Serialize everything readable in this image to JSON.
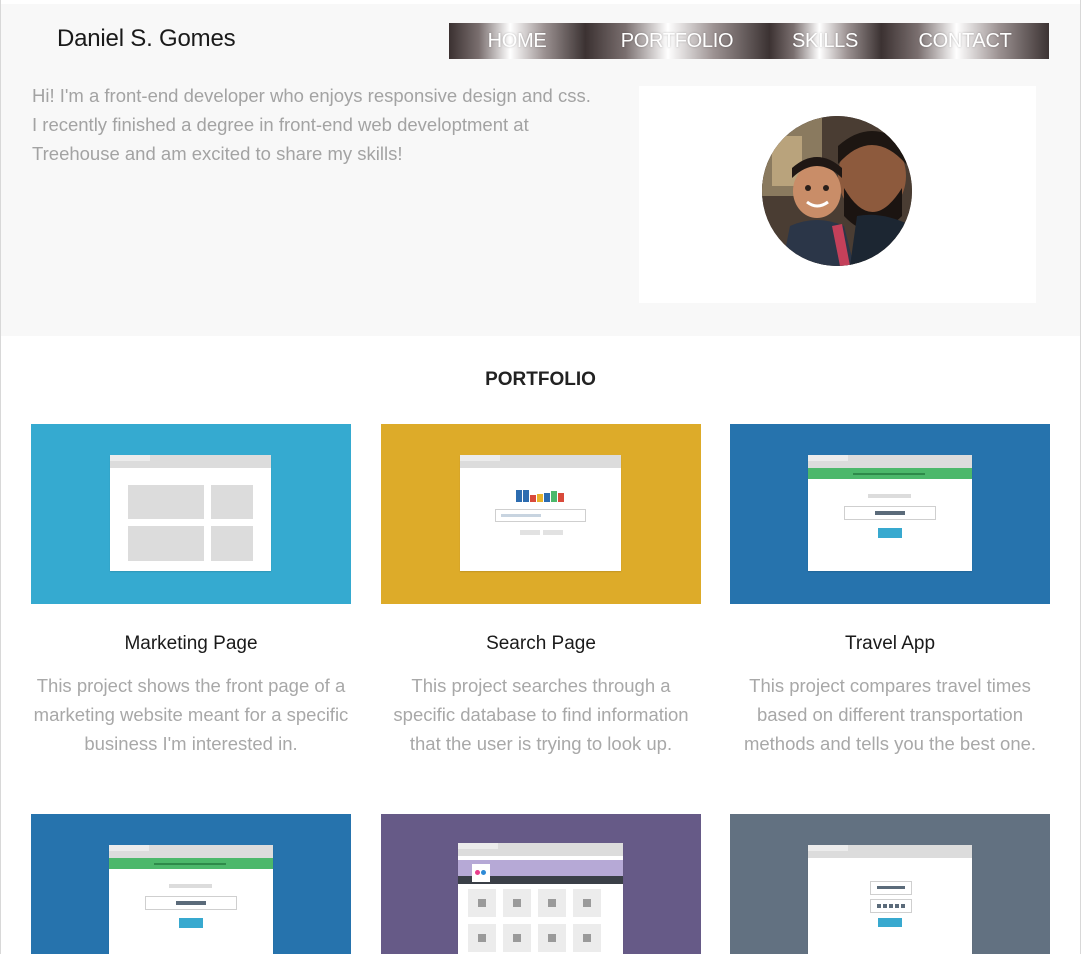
{
  "header": {
    "brand": "Daniel S. Gomes",
    "nav": [
      "HOME",
      "PORTFOLIO",
      "SKILLS",
      "CONTACT"
    ]
  },
  "intro": {
    "text": "Hi! I'm a front-end developer who enjoys responsive design and css. I recently finished a degree in front-end web developtment at Treehouse and am excited to share my skills!"
  },
  "portfolio": {
    "title": "PORTFOLIO",
    "projects": [
      {
        "title": "Marketing Page",
        "description": "This project shows the front page of a marketing website meant for a specific business I'm interested in.",
        "thumb_color": "#35aad0"
      },
      {
        "title": "Search Page",
        "description": "This project searches through a specific database to find information that the user is trying to look up.",
        "thumb_color": "#ddab29"
      },
      {
        "title": "Travel App",
        "description": "This project compares travel times based on different transportation methods and tells you the best one.",
        "thumb_color": "#2673ad"
      },
      {
        "title": "",
        "description": "",
        "thumb_color": "#2673ad"
      },
      {
        "title": "",
        "description": "",
        "thumb_color": "#665a87"
      },
      {
        "title": "",
        "description": "",
        "thumb_color": "#627181"
      }
    ]
  },
  "colors": {
    "hero_bg": "#f8f8f8",
    "text_muted": "#a8a8a8",
    "accent_green": "#4cb86b",
    "accent_blue": "#38a9cf"
  }
}
